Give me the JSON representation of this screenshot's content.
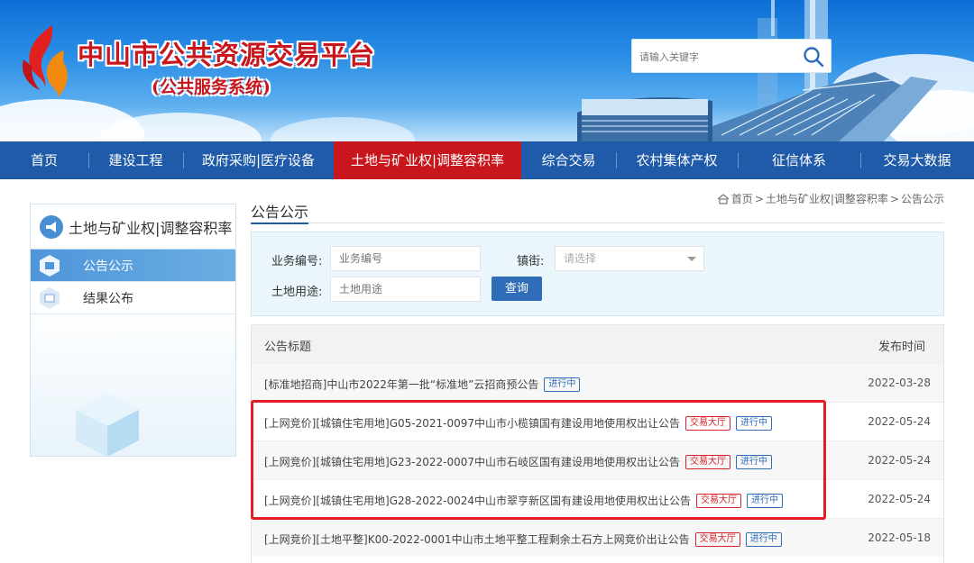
{
  "header": {
    "site_title": "中山市公共资源交易平台",
    "site_subtitle": "(公共服务系统)",
    "search_placeholder": "请输入关键字"
  },
  "nav": {
    "items": [
      {
        "label": "首页"
      },
      {
        "label": "建设工程"
      },
      {
        "label": "政府采购|医疗设备"
      },
      {
        "label": "土地与矿业权|调整容积率",
        "active": true
      },
      {
        "label": "综合交易"
      },
      {
        "label": "农村集体产权"
      },
      {
        "label": "征信体系"
      },
      {
        "label": "交易大数据"
      }
    ]
  },
  "sidebar": {
    "title": "土地与矿业权|调整容积率",
    "items": [
      {
        "label": "公告公示",
        "active": true
      },
      {
        "label": "结果公布"
      }
    ]
  },
  "breadcrumb": {
    "home": "首页",
    "level1": "土地与矿业权|调整容积率",
    "level2": "公告公示",
    "separator": ">"
  },
  "main": {
    "title": "公告公示"
  },
  "filter": {
    "biz_no_label": "业务编号:",
    "biz_no_placeholder": "业务编号",
    "street_label": "镇街:",
    "street_placeholder": "请选择",
    "land_use_label": "土地用途:",
    "land_use_placeholder": "土地用途",
    "search_button": "查询"
  },
  "table": {
    "col_title": "公告标题",
    "col_date": "发布时间",
    "rows": [
      {
        "title": "[标准地招商]中山市2022年第一批“标准地”云招商预公告",
        "badges": [
          "进行中"
        ],
        "date": "2022-03-28"
      },
      {
        "title": "[上网竞价][城镇住宅用地]G05-2021-0097中山市小榄镇国有建设用地使用权出让公告",
        "badges": [
          "交易大厅",
          "进行中"
        ],
        "date": "2022-05-24"
      },
      {
        "title": "[上网竞价][城镇住宅用地]G23-2022-0007中山市石岐区国有建设用地使用权出让公告",
        "badges": [
          "交易大厅",
          "进行中"
        ],
        "date": "2022-05-24"
      },
      {
        "title": "[上网竞价][城镇住宅用地]G28-2022-0024中山市翠亨新区国有建设用地使用权出让公告",
        "badges": [
          "交易大厅",
          "进行中"
        ],
        "date": "2022-05-24"
      },
      {
        "title": "[上网竞价][土地平整]K00-2022-0001中山市土地平整工程剩余土石方上网竞价出让公告",
        "badges": [
          "交易大厅",
          "进行中"
        ],
        "date": "2022-05-18"
      }
    ]
  },
  "colors": {
    "nav_bg": "#1f5ba8",
    "nav_active": "#c8161d",
    "highlight": "#e51c23",
    "badge_red": "#d9232a",
    "badge_blue": "#2f6db8"
  }
}
